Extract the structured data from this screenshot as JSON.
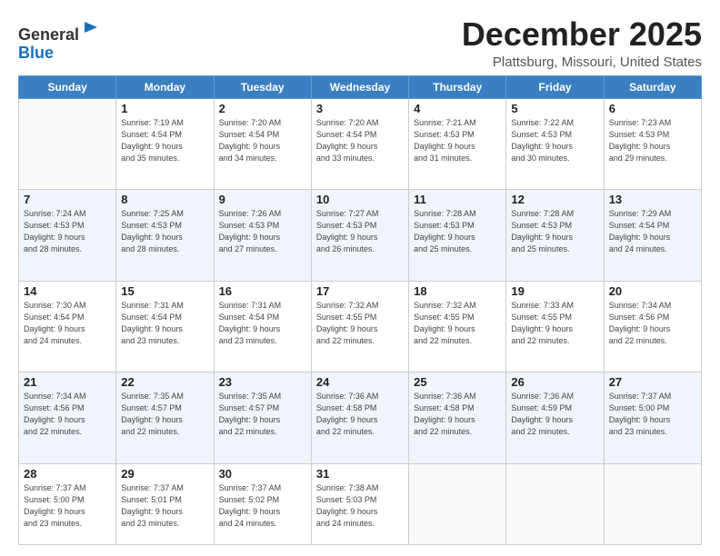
{
  "logo": {
    "general": "General",
    "blue": "Blue"
  },
  "header": {
    "month": "December 2025",
    "location": "Plattsburg, Missouri, United States"
  },
  "weekdays": [
    "Sunday",
    "Monday",
    "Tuesday",
    "Wednesday",
    "Thursday",
    "Friday",
    "Saturday"
  ],
  "weeks": [
    [
      {
        "day": "",
        "info": ""
      },
      {
        "day": "1",
        "info": "Sunrise: 7:19 AM\nSunset: 4:54 PM\nDaylight: 9 hours\nand 35 minutes."
      },
      {
        "day": "2",
        "info": "Sunrise: 7:20 AM\nSunset: 4:54 PM\nDaylight: 9 hours\nand 34 minutes."
      },
      {
        "day": "3",
        "info": "Sunrise: 7:20 AM\nSunset: 4:54 PM\nDaylight: 9 hours\nand 33 minutes."
      },
      {
        "day": "4",
        "info": "Sunrise: 7:21 AM\nSunset: 4:53 PM\nDaylight: 9 hours\nand 31 minutes."
      },
      {
        "day": "5",
        "info": "Sunrise: 7:22 AM\nSunset: 4:53 PM\nDaylight: 9 hours\nand 30 minutes."
      },
      {
        "day": "6",
        "info": "Sunrise: 7:23 AM\nSunset: 4:53 PM\nDaylight: 9 hours\nand 29 minutes."
      }
    ],
    [
      {
        "day": "7",
        "info": "Sunrise: 7:24 AM\nSunset: 4:53 PM\nDaylight: 9 hours\nand 28 minutes."
      },
      {
        "day": "8",
        "info": "Sunrise: 7:25 AM\nSunset: 4:53 PM\nDaylight: 9 hours\nand 28 minutes."
      },
      {
        "day": "9",
        "info": "Sunrise: 7:26 AM\nSunset: 4:53 PM\nDaylight: 9 hours\nand 27 minutes."
      },
      {
        "day": "10",
        "info": "Sunrise: 7:27 AM\nSunset: 4:53 PM\nDaylight: 9 hours\nand 26 minutes."
      },
      {
        "day": "11",
        "info": "Sunrise: 7:28 AM\nSunset: 4:53 PM\nDaylight: 9 hours\nand 25 minutes."
      },
      {
        "day": "12",
        "info": "Sunrise: 7:28 AM\nSunset: 4:53 PM\nDaylight: 9 hours\nand 25 minutes."
      },
      {
        "day": "13",
        "info": "Sunrise: 7:29 AM\nSunset: 4:54 PM\nDaylight: 9 hours\nand 24 minutes."
      }
    ],
    [
      {
        "day": "14",
        "info": "Sunrise: 7:30 AM\nSunset: 4:54 PM\nDaylight: 9 hours\nand 24 minutes."
      },
      {
        "day": "15",
        "info": "Sunrise: 7:31 AM\nSunset: 4:54 PM\nDaylight: 9 hours\nand 23 minutes."
      },
      {
        "day": "16",
        "info": "Sunrise: 7:31 AM\nSunset: 4:54 PM\nDaylight: 9 hours\nand 23 minutes."
      },
      {
        "day": "17",
        "info": "Sunrise: 7:32 AM\nSunset: 4:55 PM\nDaylight: 9 hours\nand 22 minutes."
      },
      {
        "day": "18",
        "info": "Sunrise: 7:32 AM\nSunset: 4:55 PM\nDaylight: 9 hours\nand 22 minutes."
      },
      {
        "day": "19",
        "info": "Sunrise: 7:33 AM\nSunset: 4:55 PM\nDaylight: 9 hours\nand 22 minutes."
      },
      {
        "day": "20",
        "info": "Sunrise: 7:34 AM\nSunset: 4:56 PM\nDaylight: 9 hours\nand 22 minutes."
      }
    ],
    [
      {
        "day": "21",
        "info": "Sunrise: 7:34 AM\nSunset: 4:56 PM\nDaylight: 9 hours\nand 22 minutes."
      },
      {
        "day": "22",
        "info": "Sunrise: 7:35 AM\nSunset: 4:57 PM\nDaylight: 9 hours\nand 22 minutes."
      },
      {
        "day": "23",
        "info": "Sunrise: 7:35 AM\nSunset: 4:57 PM\nDaylight: 9 hours\nand 22 minutes."
      },
      {
        "day": "24",
        "info": "Sunrise: 7:36 AM\nSunset: 4:58 PM\nDaylight: 9 hours\nand 22 minutes."
      },
      {
        "day": "25",
        "info": "Sunrise: 7:36 AM\nSunset: 4:58 PM\nDaylight: 9 hours\nand 22 minutes."
      },
      {
        "day": "26",
        "info": "Sunrise: 7:36 AM\nSunset: 4:59 PM\nDaylight: 9 hours\nand 22 minutes."
      },
      {
        "day": "27",
        "info": "Sunrise: 7:37 AM\nSunset: 5:00 PM\nDaylight: 9 hours\nand 23 minutes."
      }
    ],
    [
      {
        "day": "28",
        "info": "Sunrise: 7:37 AM\nSunset: 5:00 PM\nDaylight: 9 hours\nand 23 minutes."
      },
      {
        "day": "29",
        "info": "Sunrise: 7:37 AM\nSunset: 5:01 PM\nDaylight: 9 hours\nand 23 minutes."
      },
      {
        "day": "30",
        "info": "Sunrise: 7:37 AM\nSunset: 5:02 PM\nDaylight: 9 hours\nand 24 minutes."
      },
      {
        "day": "31",
        "info": "Sunrise: 7:38 AM\nSunset: 5:03 PM\nDaylight: 9 hours\nand 24 minutes."
      },
      {
        "day": "",
        "info": ""
      },
      {
        "day": "",
        "info": ""
      },
      {
        "day": "",
        "info": ""
      }
    ]
  ]
}
